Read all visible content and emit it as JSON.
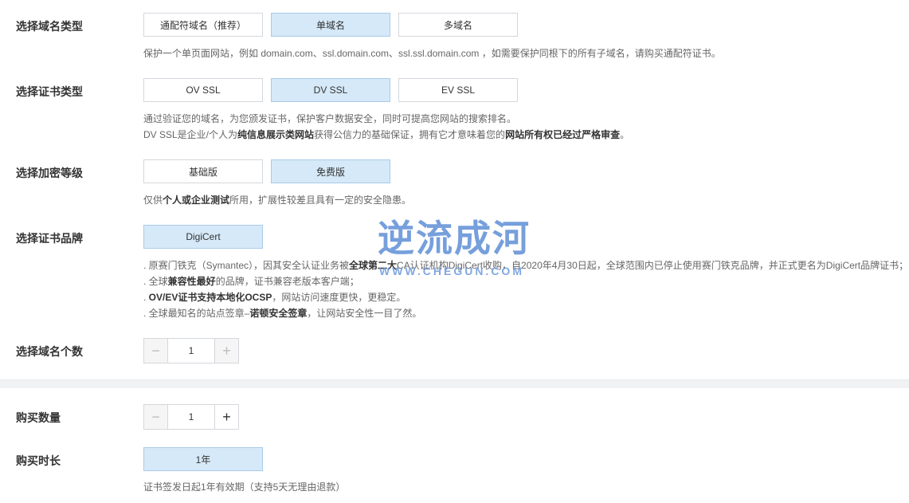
{
  "domain_type": {
    "label": "选择域名类型",
    "options": [
      "通配符域名（推荐）",
      "单域名",
      "多域名"
    ],
    "selected": "单域名",
    "desc": "保护一个单页面网站，例如 domain.com、ssl.domain.com、ssl.ssl.domain.com ，如需要保护同根下的所有子域名，请购买通配符证书。"
  },
  "cert_type": {
    "label": "选择证书类型",
    "options": [
      "OV SSL",
      "DV SSL",
      "EV SSL"
    ],
    "selected": "DV SSL",
    "desc1": "通过验证您的域名，为您颁发证书，保护客户数据安全，同时可提高您网站的搜索排名。",
    "desc2_a": "DV SSL是企业/个人为",
    "desc2_b": "纯信息展示类网站",
    "desc2_c": "获得公信力的基础保证，拥有它才意味着您的",
    "desc2_d": "网站所有权已经过严格审查",
    "desc2_e": "。"
  },
  "encrypt_level": {
    "label": "选择加密等级",
    "options": [
      "基础版",
      "免费版"
    ],
    "selected": "免费版",
    "desc_a": "仅供",
    "desc_b": "个人或企业测试",
    "desc_c": "所用，扩展性较差且具有一定的安全隐患。"
  },
  "brand": {
    "label": "选择证书品牌",
    "options": [
      "DigiCert"
    ],
    "selected": "DigiCert",
    "line1_a": ". 原赛门铁克（Symantec），因其安全认证业务被",
    "line1_b": "全球第二大",
    "line1_c": "CA认证机构DigiCert收购，自2020年4月30日起，全球范围内已停止使用赛门铁克品牌，并正式更名为DigiCert品牌证书；",
    "line2_a": ". 全球",
    "line2_b": "兼容性最好",
    "line2_c": "的品牌，证书兼容老版本客户端；",
    "line3_a": ". ",
    "line3_b": "OV/EV证书支持本地化OCSP",
    "line3_c": "，网站访问速度更快，更稳定。",
    "line4_a": ". 全球最知名的站点签章–",
    "line4_b": "诺顿安全签章",
    "line4_c": "，让网站安全性一目了然。"
  },
  "domain_count": {
    "label": "选择域名个数",
    "minus": "−",
    "value": "1",
    "plus": "+"
  },
  "quantity": {
    "label": "购买数量",
    "minus": "−",
    "value": "1",
    "plus": "+"
  },
  "duration": {
    "label": "购买时长",
    "options": [
      "1年"
    ],
    "selected": "1年",
    "desc": "证书签发日起1年有效期（支持5天无理由退款）"
  },
  "watermark": {
    "title": "逆流成河",
    "url": "WWW.CHEGUN.COM"
  }
}
